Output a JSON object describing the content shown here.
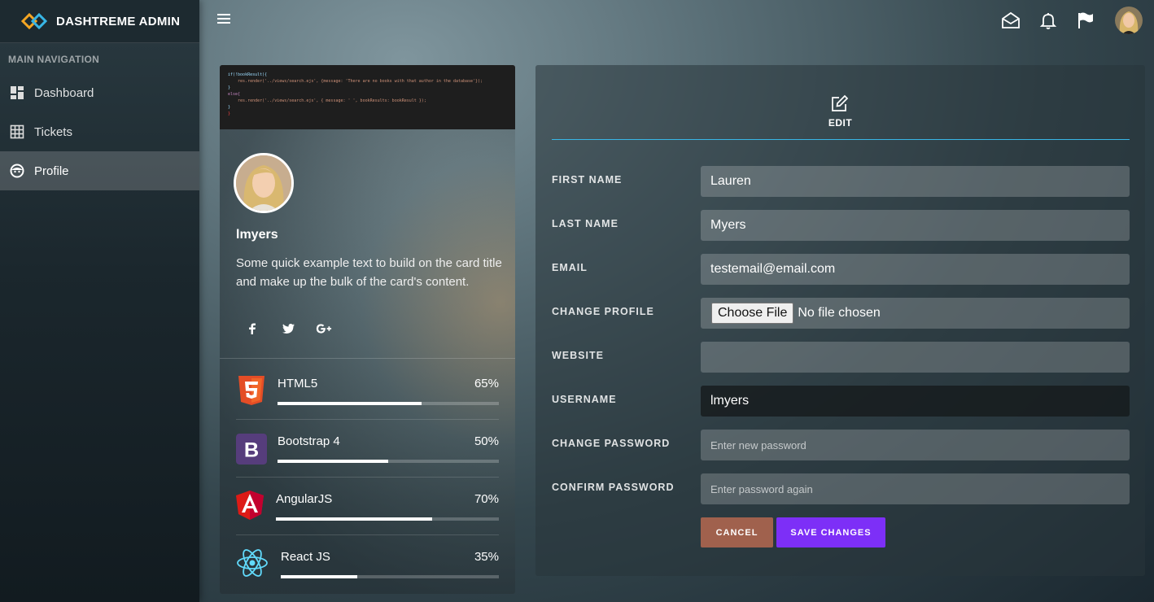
{
  "brand": {
    "title": "DASHTREME ADMIN"
  },
  "sidebar": {
    "header": "MAIN NAVIGATION",
    "items": [
      {
        "label": "Dashboard",
        "icon": "dashboard-icon"
      },
      {
        "label": "Tickets",
        "icon": "grid-icon"
      },
      {
        "label": "Profile",
        "icon": "face-icon",
        "active": true
      }
    ]
  },
  "topbar": {
    "icons": [
      "envelope-open-icon",
      "bell-icon",
      "flag-icon"
    ]
  },
  "profile": {
    "code_lines": [
      "if(!bookResult){",
      "",
      "    res.render('../views/search.ejs', {message: 'There are no books with that author in the database'});",
      "}",
      "",
      "else{",
      "    res.render('../views/search.ejs', { message: ' ', bookResults: bookResult });",
      "}",
      "}"
    ],
    "name": "lmyers",
    "text": "Some quick example text to build on the card title and make up the bulk of the card's content.",
    "social": [
      "facebook-icon",
      "twitter-icon",
      "google-plus-icon"
    ],
    "skills": [
      {
        "name": "HTML5",
        "percent_label": "65%",
        "percent": 65,
        "icon": "html5-icon",
        "color": "#e44d26"
      },
      {
        "name": "Bootstrap 4",
        "percent_label": "50%",
        "percent": 50,
        "icon": "bootstrap-icon",
        "color": "#563d7c"
      },
      {
        "name": "AngularJS",
        "percent_label": "70%",
        "percent": 70,
        "icon": "angular-icon",
        "color": "#dd1b16"
      },
      {
        "name": "React JS",
        "percent_label": "35%",
        "percent": 35,
        "icon": "react-icon",
        "color": "#61dafb"
      }
    ]
  },
  "edit": {
    "tab_label": "EDIT",
    "fields": {
      "first_name": {
        "label": "FIRST NAME",
        "value": "Lauren"
      },
      "last_name": {
        "label": "LAST NAME",
        "value": "Myers"
      },
      "email": {
        "label": "EMAIL",
        "value": "testemail@email.com"
      },
      "change_profile": {
        "label": "CHANGE PROFILE",
        "button": "Choose File",
        "status": "No file chosen"
      },
      "website": {
        "label": "WEBSITE",
        "value": ""
      },
      "username": {
        "label": "USERNAME",
        "value": "lmyers"
      },
      "password": {
        "label": "CHANGE PASSWORD",
        "placeholder": "Enter new password"
      },
      "confirm_password": {
        "label": "CONFIRM PASSWORD",
        "placeholder": "Enter password again"
      }
    },
    "buttons": {
      "cancel": "CANCEL",
      "save": "SAVE CHANGES"
    }
  },
  "colors": {
    "accent_line": "#38b6e6",
    "save_button": "#7d2ff7",
    "cancel_button": "#a0614d"
  }
}
